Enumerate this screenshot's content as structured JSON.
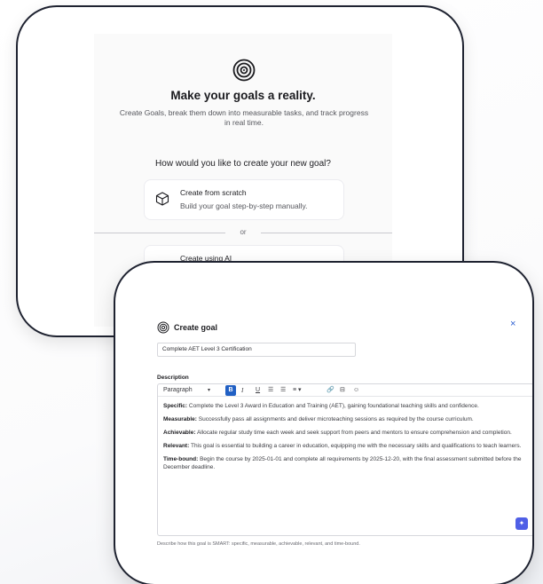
{
  "intro": {
    "icon": "target-icon",
    "title": "Make your goals a reality.",
    "subtitle": "Create Goals, break them down into measurable tasks, and track progress in real time.",
    "question": "How would you like to create your new goal?",
    "option_scratch": {
      "title": "Create from scratch",
      "description": "Build your goal step-by-step manually.",
      "icon": "cube-icon"
    },
    "divider": "or",
    "option_ai": {
      "title": "Create using AI"
    }
  },
  "create_goal": {
    "title": "Create goal",
    "icon": "target-icon",
    "close": "×",
    "goal_name": "Complete AET Level 3 Certification",
    "description_label": "Description",
    "toolbar": {
      "paragraph": "Paragraph",
      "caret": "▾",
      "bold": "B",
      "italic": "I",
      "underline": "U",
      "list1": "☰",
      "list2": "☰",
      "align": "≡ ▾",
      "link": "🔗",
      "table": "⊟",
      "emoji": "☺"
    },
    "paragraphs": [
      {
        "label": "Specific:",
        "text": "Complete the Level 3 Award in Education and Training (AET), gaining foundational teaching skills and confidence."
      },
      {
        "label": "Measurable:",
        "text": "Successfully pass all assignments and deliver microteaching sessions as required by the course curriculum."
      },
      {
        "label": "Achievable:",
        "text": "Allocate regular study time each week and seek support from peers and mentors to ensure comprehension and completion."
      },
      {
        "label": "Relevant:",
        "text": "This goal is essential to building a career in education, equipping me with the necessary skills and qualifications to teach learners."
      },
      {
        "label": "Time-bound:",
        "text": "Begin the course by 2025-01-01 and complete all requirements by 2025-12-20, with the final assessment submitted before the December deadline."
      }
    ],
    "ai_button": "✦",
    "helper_text": "Describe how this goal is SMART: specific, measurable, achievable, relevant, and time-bound."
  }
}
